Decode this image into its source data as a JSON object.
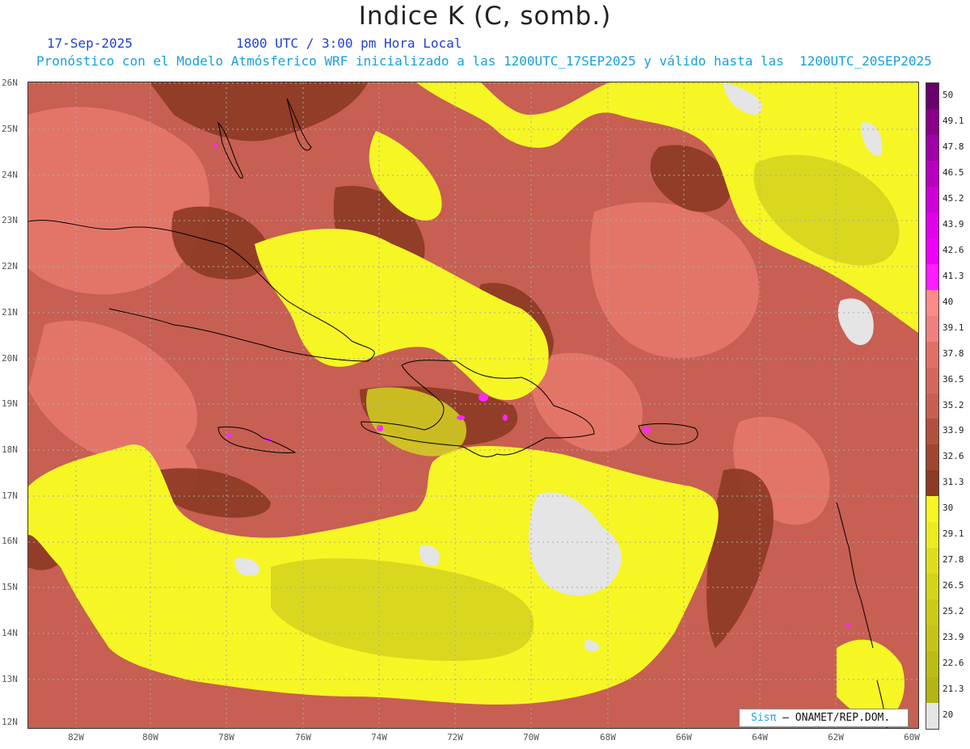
{
  "title": "Indice K (C, somb.)",
  "header": {
    "date": "17-Sep-2025",
    "time": "1800 UTC / 3:00 pm Hora Local",
    "forecast": "Pronóstico con el Modelo Atmósferico WRF inicializado a las 1200UTC_17SEP2025 y válido hasta las  1200UTC_20SEP2025"
  },
  "map": {
    "lat_labels": [
      "26N",
      "25N",
      "24N",
      "23N",
      "22N",
      "21N",
      "20N",
      "19N",
      "18N",
      "17N",
      "16N",
      "15N",
      "14N",
      "13N",
      "12N"
    ],
    "lon_labels": [
      "82W",
      "80W",
      "78W",
      "76W",
      "74W",
      "72W",
      "70W",
      "68W",
      "66W",
      "64W",
      "62W",
      "60W"
    ],
    "colors": {
      "ocean_base": "#c75f52",
      "dark": "#8c3a24",
      "light": "#e8796c",
      "yellow": "#f6f625",
      "olive": "#d4d21e",
      "gray": "#e5e5e5",
      "magenta": "#ff26ff"
    }
  },
  "colorbar": {
    "labels": [
      "50",
      "49.1",
      "47.8",
      "46.5",
      "45.2",
      "43.9",
      "42.6",
      "41.3",
      "40",
      "39.1",
      "37.8",
      "36.5",
      "35.2",
      "33.9",
      "32.6",
      "31.3",
      "30",
      "29.1",
      "27.8",
      "26.5",
      "25.2",
      "23.9",
      "22.6",
      "21.3",
      "20"
    ],
    "colors": [
      "#6a006a",
      "#8a008a",
      "#a000a8",
      "#b800c0",
      "#cc00d6",
      "#e000ea",
      "#f000f8",
      "#ff1cff",
      "#ff8a8a",
      "#f08080",
      "#e07066",
      "#d4675c",
      "#c75f52",
      "#b2503f",
      "#a04530",
      "#8c3a24",
      "#f6f625",
      "#ebeb20",
      "#dede1e",
      "#d4d41c",
      "#caca1a",
      "#c4c418",
      "#bcbc16",
      "#b4b414",
      "#e5e5e5"
    ]
  },
  "credit": {
    "brand": "Sisπ",
    "org": "– ONAMET/REP.DOM."
  }
}
